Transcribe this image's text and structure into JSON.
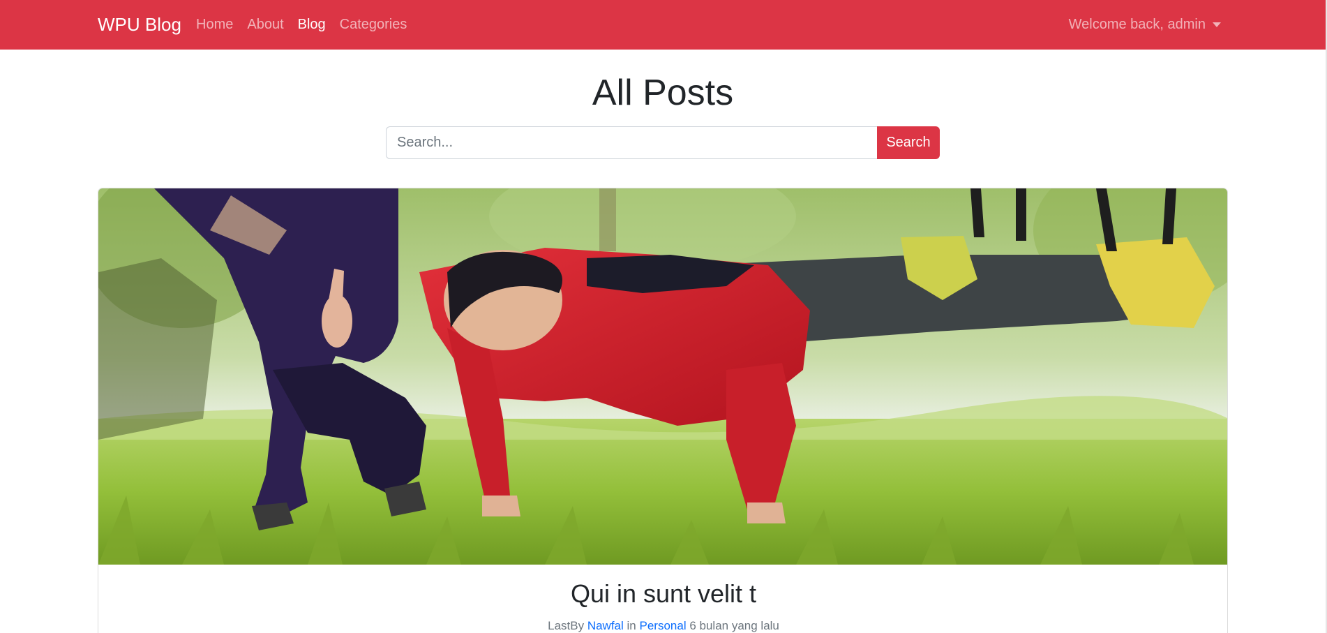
{
  "navbar": {
    "brand": "WPU Blog",
    "links": [
      {
        "label": "Home",
        "active": false
      },
      {
        "label": "About",
        "active": false
      },
      {
        "label": "Blog",
        "active": true
      },
      {
        "label": "Categories",
        "active": false
      }
    ],
    "user_menu": "Welcome back, admin",
    "color": "#dc3545"
  },
  "main": {
    "title": "All Posts",
    "search": {
      "placeholder": "Search...",
      "value": "",
      "button_label": "Search"
    }
  },
  "featured_post": {
    "title": "Qui in sunt velit t",
    "meta": {
      "prefix": "LastBy",
      "author": "Nawfal",
      "connector": "in",
      "category": "Personal",
      "time": "6 bulan yang lalu"
    },
    "link_color": "#0d6efd"
  }
}
